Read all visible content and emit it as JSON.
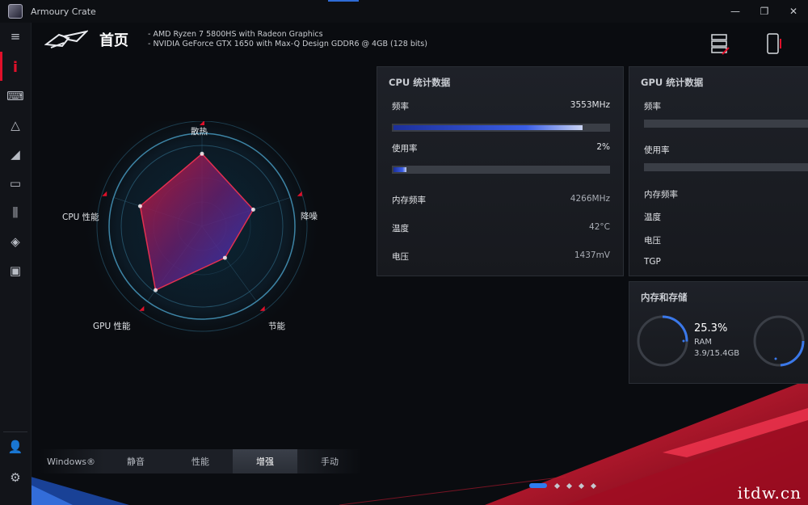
{
  "window": {
    "title": "Armoury Crate",
    "min": "—",
    "max": "❐",
    "close": "✕"
  },
  "header": {
    "title": "首页",
    "cpu_info": "AMD Ryzen 7 5800HS with Radeon Graphics",
    "gpu_info": "NVIDIA GeForce GTX 1650 with Max-Q Design GDDR6 @ 4GB (128 bits)"
  },
  "sidebar": {
    "items": [
      {
        "icon": "menu-icon"
      },
      {
        "icon": "home-icon"
      },
      {
        "icon": "keyboard-icon"
      },
      {
        "icon": "aura-icon"
      },
      {
        "icon": "gamevisual-icon"
      },
      {
        "icon": "gamepad-icon"
      },
      {
        "icon": "equalizer-icon"
      },
      {
        "icon": "tag-icon"
      },
      {
        "icon": "library-icon"
      },
      {
        "icon": "user-icon"
      },
      {
        "icon": "settings-icon"
      }
    ]
  },
  "radar": {
    "labels": {
      "top": "散热",
      "right": "降噪",
      "bottom_right": "节能",
      "bottom_left": "GPU 性能",
      "left": "CPU 性能"
    },
    "values": {
      "cooling": 0.78,
      "noise": 0.58,
      "power_saving": 0.42,
      "gpu": 0.85,
      "cpu": 0.7
    },
    "colors": {
      "fill_red": "#c0182e",
      "fill_blue": "#2a3ac8"
    }
  },
  "modes": {
    "items": [
      "Windows®",
      "静音",
      "性能",
      "增强",
      "手动"
    ],
    "active": "增强"
  },
  "cpu_card": {
    "title": "CPU 统计数据",
    "freq_label": "频率",
    "freq_value": "3553MHz",
    "freq_fraction": 0.88,
    "usage_label": "使用率",
    "usage_value": "2%",
    "usage_fraction": 0.06,
    "mem_freq_label": "内存频率",
    "mem_freq_value": "4266MHz",
    "temp_label": "温度",
    "temp_value": "42°C",
    "voltage_label": "电压",
    "voltage_value": "1437mV"
  },
  "gpu_card": {
    "title": "GPU 统计数据",
    "freq_label": "频率",
    "usage_label": "使用率",
    "mem_freq_label": "内存频率",
    "temp_label": "温度",
    "voltage_label": "电压",
    "tgp_label": "TGP"
  },
  "memory_card": {
    "title": "内存和存储",
    "ram_percent": "25.3%",
    "ram_fraction": 0.253,
    "ram_label": "RAM",
    "ram_detail": "3.9/15.4GB"
  },
  "pager": {
    "count": 5,
    "active": 0
  },
  "watermark": "itdw.cn",
  "accent": {
    "red": "#e0102a",
    "blue": "#2e7cf0"
  }
}
